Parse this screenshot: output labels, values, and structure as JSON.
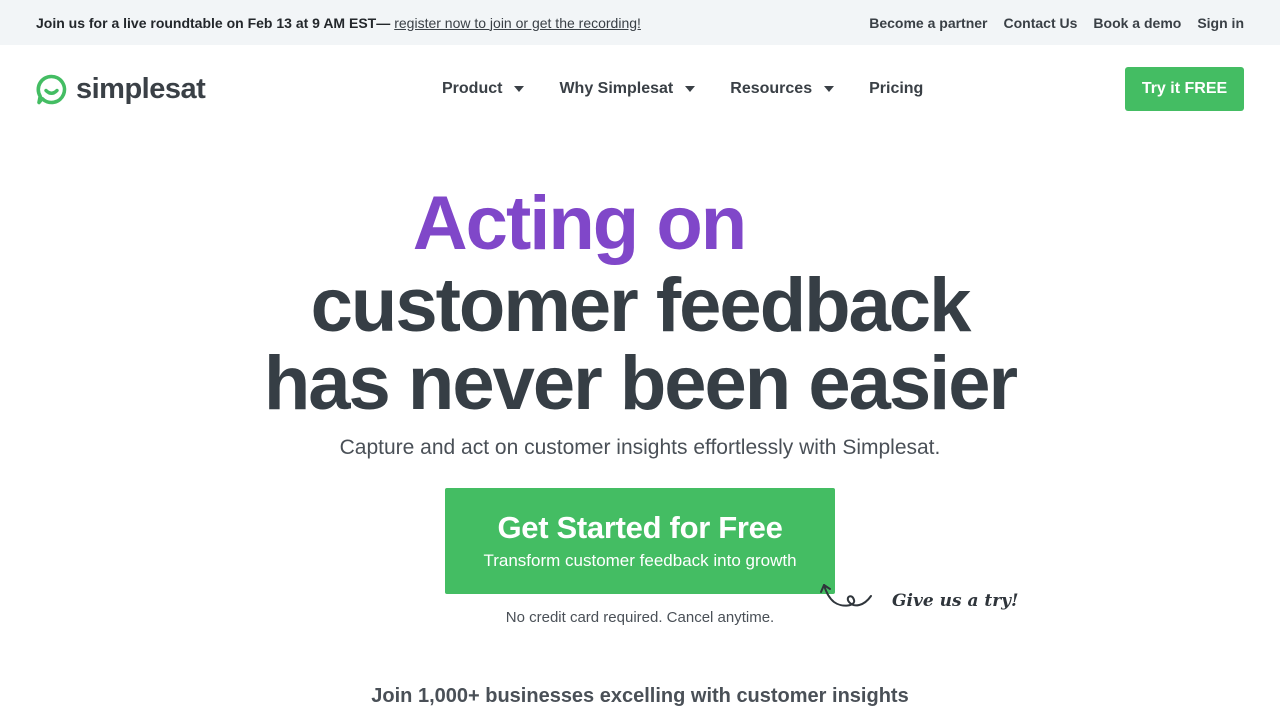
{
  "announcement": {
    "glyph": "",
    "lead": "Join us for a live roundtable on Feb 13 at 9 AM EST—",
    "link": "register now to join or get the recording!",
    "right_links": [
      "Become a partner",
      "Contact Us",
      "Book a demo",
      "Sign in"
    ]
  },
  "header": {
    "logo_text": "simplesat",
    "nav": [
      {
        "label": "Product",
        "has_dropdown": true
      },
      {
        "label": "Why Simplesat",
        "has_dropdown": true
      },
      {
        "label": "Resources",
        "has_dropdown": true
      },
      {
        "label": "Pricing",
        "has_dropdown": false
      }
    ],
    "cta": "Try it FREE"
  },
  "hero": {
    "line1": "Acting on",
    "line2": "customer feedback",
    "line3": "has never been easier",
    "subtitle": "Capture and act on customer insights effortlessly with Simplesat.",
    "cta_title": "Get Started for Free",
    "cta_subtitle": "Transform customer feedback into growth",
    "note": "No credit card required. Cancel anytime.",
    "doodle_glyph": "",
    "doodle_text": "Give us a try!"
  },
  "social_proof": {
    "heading": "Join 1,000+ businesses excelling with customer insights"
  },
  "colors": {
    "brand_green": "#44bd63",
    "accent_purple": "#8047c9",
    "text_dark": "#363e45",
    "bar_bg": "#f2f5f7"
  },
  "icons": {
    "logo": "chat-bubble-smile-icon",
    "dropdown": "caret-down-icon",
    "doodle": "curly-arrow-icon"
  }
}
